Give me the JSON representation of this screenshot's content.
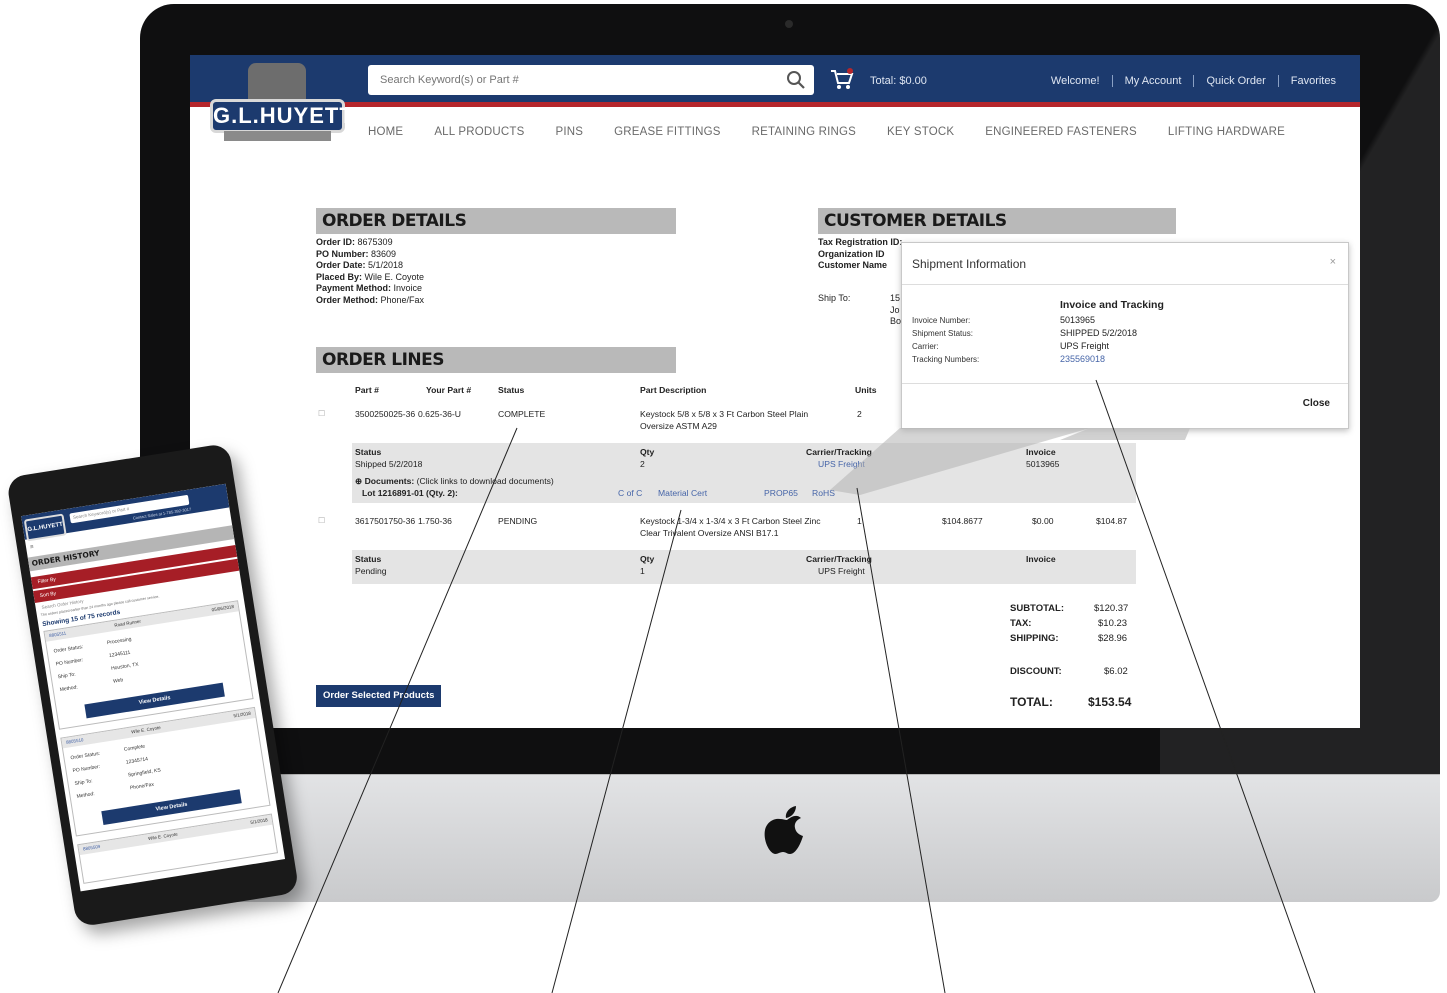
{
  "header": {
    "logo_text": "G.L.HUYETT",
    "search_placeholder": "Search Keyword(s) or Part #",
    "cart_total": "Total: $0.00",
    "links": [
      "Welcome!",
      "My Account",
      "Quick Order",
      "Favorites"
    ]
  },
  "nav": [
    "HOME",
    "ALL PRODUCTS",
    "PINS",
    "GREASE FITTINGS",
    "RETAINING RINGS",
    "KEY STOCK",
    "ENGINEERED FASTENERS",
    "LIFTING HARDWARE"
  ],
  "order_details": {
    "title": "ORDER DETAILS",
    "order_id_label": "Order ID:",
    "order_id": "8675309",
    "po_label": "PO Number:",
    "po": "83609",
    "date_label": "Order Date:",
    "date": "5/1/2018",
    "placed_label": "Placed By:",
    "placed": "Wile E. Coyote",
    "payment_label": "Payment Method:",
    "payment": "Invoice",
    "method_label": "Order Method:",
    "method": "Phone/Fax"
  },
  "customer_details": {
    "title": "CUSTOMER DETAILS",
    "tax_label": "Tax Registration ID:",
    "org_label": "Organization ID",
    "name_label": "Customer Name",
    "ship_label": "Ship To:",
    "ship_lines": [
      "15",
      "Jo",
      "Bo"
    ]
  },
  "order_lines": {
    "title": "ORDER LINES",
    "headers": {
      "part": "Part #",
      "your_part": "Your Part #",
      "status": "Status",
      "desc": "Part Description",
      "units": "Units"
    },
    "line1": {
      "part": "3500250025-36",
      "your_part": "0.625-36-U",
      "status": "COMPLETE",
      "desc1": "Keystock 5/8 x 5/8 x 3 Ft Carbon Steel Plain",
      "desc2": "Oversize ASTM A29",
      "units": "2",
      "sub": {
        "status_label": "Status",
        "status": "Shipped 5/2/2018",
        "qty_label": "Qty",
        "qty": "2",
        "carrier_label": "Carrier/Tracking",
        "carrier": "UPS Freight",
        "invoice_label": "Invoice",
        "invoice": "5013965",
        "docs_label": "Documents:",
        "docs_hint": "(Click links to download documents)",
        "lot": "Lot 1216891-01 (Qty. 2):",
        "doc_links": [
          "C of C",
          "Material Cert",
          "PROP65",
          "RoHS"
        ]
      }
    },
    "line2": {
      "part": "3617501750-36",
      "your_part": "1.750-36",
      "status": "PENDING",
      "desc1": "Keystock 1-3/4 x 1-3/4 x 3 Ft Carbon Steel Zinc",
      "desc2": "Clear Trivalent Oversize ANSI B17.1",
      "units": "1",
      "price": "$104.8677",
      "discount": "$0.00",
      "ext": "$104.87",
      "sub": {
        "status_label": "Status",
        "status": "Pending",
        "qty_label": "Qty",
        "qty": "1",
        "carrier_label": "Carrier/Tracking",
        "carrier": "UPS Freight",
        "invoice_label": "Invoice"
      }
    }
  },
  "totals": {
    "subtotal_label": "SUBTOTAL:",
    "subtotal": "$120.37",
    "tax_label": "TAX:",
    "tax": "$10.23",
    "shipping_label": "SHIPPING:",
    "shipping": "$28.96",
    "discount_label": "DISCOUNT:",
    "discount": "$6.02",
    "total_label": "TOTAL:",
    "total": "$153.54"
  },
  "order_button": "Order Selected Products",
  "modal": {
    "title": "Shipment Information",
    "close_x": "×",
    "section_title": "Invoice and Tracking",
    "invoice_label": "Invoice Number:",
    "invoice": "5013965",
    "status_label": "Shipment Status:",
    "status": "SHIPPED 5/2/2018",
    "carrier_label": "Carrier:",
    "carrier": "UPS Freight",
    "tracking_label": "Tracking Numbers:",
    "tracking": "235569018",
    "close_button": "Close"
  },
  "phone": {
    "logo_text": "G.L.HUYETT",
    "search_placeholder": "Search Keyword(s) or Part #",
    "header_link": "Contact Sales at 1-785-392-3017",
    "section_title": "ORDER HISTORY",
    "filters": [
      "Filter By",
      "Sort By"
    ],
    "search_hint": "Search Order History",
    "info_text": "The orders placed earlier than 24 months ago please call customer service.",
    "count_text": "Showing 15 of 75 records",
    "cards": [
      {
        "id": "8805511",
        "name": "Road Runner",
        "date": "05/06/2018",
        "rows": [
          [
            "Order Status:",
            "Processing"
          ],
          [
            "PO Number:",
            "12345111"
          ],
          [
            "Ship To:",
            "Houston, TX"
          ],
          [
            "Method:",
            "Web"
          ]
        ],
        "button": "View Details"
      },
      {
        "id": "8805510",
        "name": "Wile E. Coyote",
        "date": "5/1/2018",
        "rows": [
          [
            "Order Status:",
            "Complete"
          ],
          [
            "PO Number:",
            "12345714"
          ],
          [
            "Ship To:",
            "Springfield, KS"
          ],
          [
            "Method:",
            "Phone/Fax"
          ]
        ],
        "button": "View Details"
      },
      {
        "id": "8805509",
        "name": "Wile E. Coyote",
        "date": "5/1/2018"
      }
    ]
  }
}
